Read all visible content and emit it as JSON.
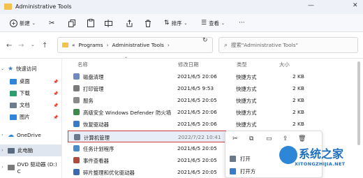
{
  "window": {
    "title": "Administrative Tools",
    "minimize": "—",
    "close": "✕"
  },
  "toolbar": {
    "new_label": "新建",
    "sort_label": "排序",
    "view_label": "查看",
    "more": "···"
  },
  "address": {
    "overflow": "«",
    "crumbs": [
      "Programs",
      "Administrative Tools"
    ],
    "search_placeholder": "搜索\"Administrative Tools\""
  },
  "nav": [
    {
      "label": "快速访问",
      "expanded": true
    },
    {
      "label": "桌面",
      "color": "#2f86d8"
    },
    {
      "label": "下载",
      "color": "#2f9e6f"
    },
    {
      "label": "文档",
      "color": "#6f7c8e"
    },
    {
      "label": "图片",
      "color": "#2f86d8"
    },
    {
      "label": "OneDrive",
      "color": "#2f86d8"
    },
    {
      "label": "此电脑",
      "color": "#5a6a7e",
      "selected": true
    },
    {
      "label": "DVD 驱动器 (D:) C",
      "color": "#7a7a7a"
    }
  ],
  "columns": {
    "name": "名称",
    "modified": "修改日期",
    "type": "类型",
    "size": "大小"
  },
  "rows": [
    {
      "name": "磁盘清理",
      "date": "2021/6/5 20:06",
      "type": "快捷方式",
      "size": "2 KB",
      "color": "#6c8cc0"
    },
    {
      "name": "打印管理",
      "date": "2021/6/5 9:53",
      "type": "快捷方式",
      "size": "2 KB",
      "color": "#7a7a7a"
    },
    {
      "name": "服务",
      "date": "2021/6/5 20:05",
      "type": "快捷方式",
      "size": "2 KB",
      "color": "#8a8a8a"
    },
    {
      "name": "高级安全 Windows Defender 防火墙",
      "date": "2021/6/5 20:06",
      "type": "快捷方式",
      "size": "2 KB",
      "color": "#3a8a4a"
    },
    {
      "name": "恢复驱动器",
      "date": "2021/6/5 20:06",
      "type": "快捷方式",
      "size": "2 KB",
      "color": "#3a7ac8"
    },
    {
      "name": "计算机管理",
      "date": "2022/7/22 10:41",
      "type": "",
      "size": "",
      "color": "#6a7a8a",
      "selected": true
    },
    {
      "name": "任务计划程序",
      "date": "2021/6/5 20:05",
      "type": "",
      "size": "",
      "color": "#4a8ac8"
    },
    {
      "name": "事件查看器",
      "date": "2021/6/5 20:05",
      "type": "",
      "size": "",
      "color": "#b04a3a"
    },
    {
      "name": "碎片整理和优化驱动器",
      "date": "2021/6/5 20:05",
      "type": "",
      "size": "",
      "color": "#3a6ab0"
    }
  ],
  "context_menu": {
    "item1": "打开",
    "item2": "打开方"
  },
  "watermark": {
    "text": "系统之家",
    "sub": "XITONGZHIJIA.NET"
  }
}
